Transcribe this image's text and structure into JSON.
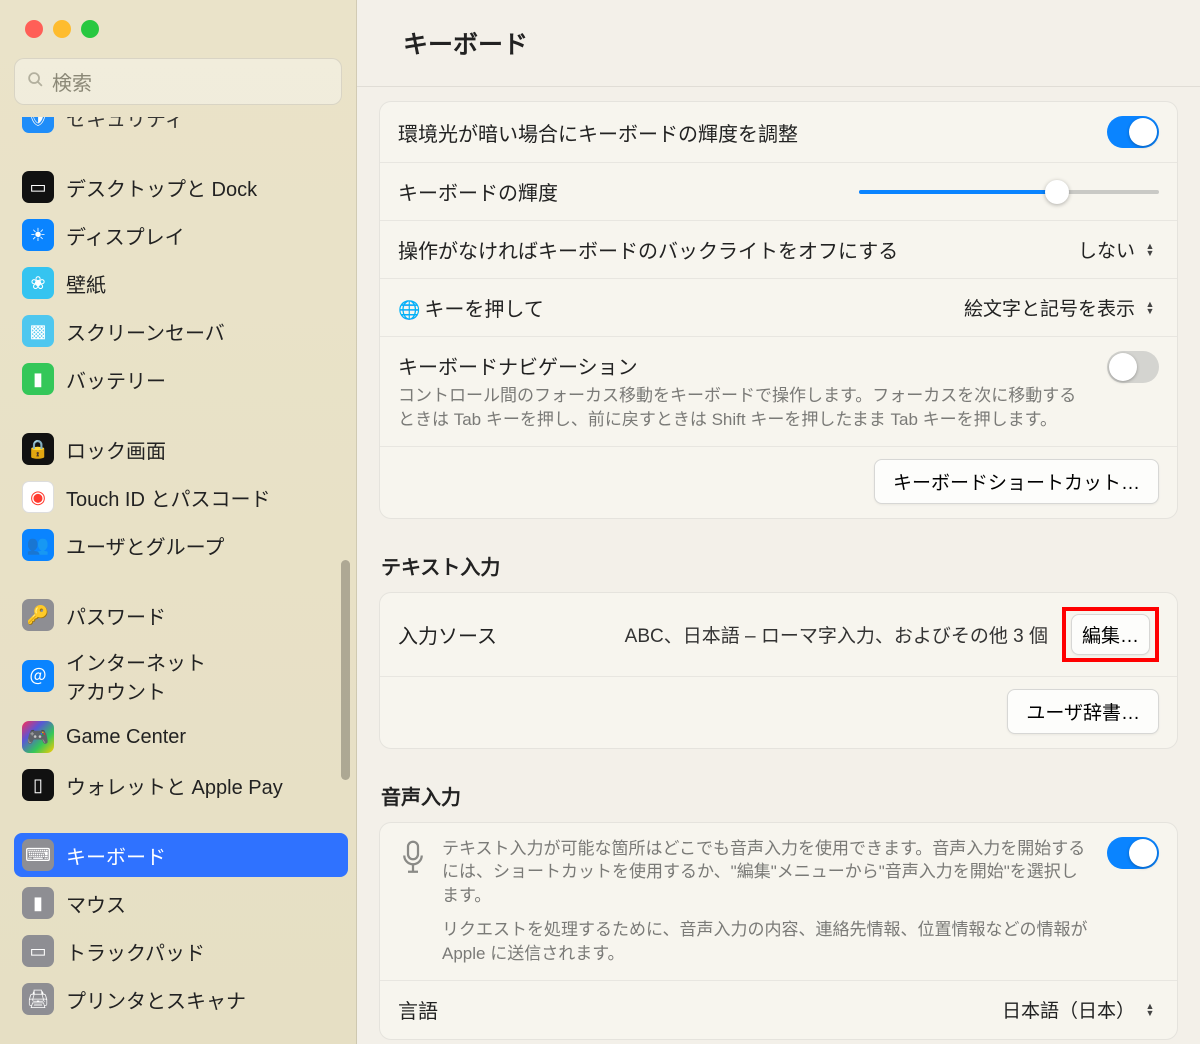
{
  "window": {
    "title": "キーボード"
  },
  "search": {
    "placeholder": "検索"
  },
  "sidebar": {
    "items": [
      {
        "label": "セキュリティ",
        "icon": "security",
        "bg": "#0a84ff"
      },
      {
        "label": "デスクトップと Dock",
        "icon": "desktop",
        "bg": "#111"
      },
      {
        "label": "ディスプレイ",
        "icon": "display",
        "bg": "#0a84ff"
      },
      {
        "label": "壁紙",
        "icon": "wallpaper",
        "bg": "#35c4f0"
      },
      {
        "label": "スクリーンセーバ",
        "icon": "screensaver",
        "bg": "#4fc7ef"
      },
      {
        "label": "バッテリー",
        "icon": "battery",
        "bg": "#34c759"
      },
      {
        "label": "ロック画面",
        "icon": "lock",
        "bg": "#111"
      },
      {
        "label": "Touch ID とパスコード",
        "icon": "touchid",
        "bg": "#fff"
      },
      {
        "label": "ユーザとグループ",
        "icon": "users",
        "bg": "#0a84ff"
      },
      {
        "label": "パスワード",
        "icon": "passwords",
        "bg": "#8e8e93"
      },
      {
        "label": "インターネット\nアカウント",
        "icon": "internet",
        "bg": "#0a84ff"
      },
      {
        "label": "Game Center",
        "icon": "gamecenter",
        "bg": "#fff"
      },
      {
        "label": "ウォレットと Apple Pay",
        "icon": "wallet",
        "bg": "#111"
      },
      {
        "label": "キーボード",
        "icon": "keyboard",
        "bg": "#8e8e93"
      },
      {
        "label": "マウス",
        "icon": "mouse",
        "bg": "#8e8e93"
      },
      {
        "label": "トラックパッド",
        "icon": "trackpad",
        "bg": "#8e8e93"
      },
      {
        "label": "プリンタとスキャナ",
        "icon": "printer",
        "bg": "#8e8e93"
      }
    ],
    "selected": "キーボード"
  },
  "main": {
    "brightness_label": "環境光が暗い場合にキーボードの輝度を調整",
    "brightness_on": true,
    "kbd_brightness_label": "キーボードの輝度",
    "backlight_off_label": "操作がなければキーボードのバックライトをオフにする",
    "backlight_off_value": "しない",
    "globe_key_label": "キーを押して",
    "globe_key_value": "絵文字と記号を表示",
    "kbd_nav_label": "キーボードナビゲーション",
    "kbd_nav_desc": "コントロール間のフォーカス移動をキーボードで操作します。フォーカスを次に移動するときは Tab キーを押し、前に戻すときは Shift キーを押したまま Tab キーを押します。",
    "kbd_nav_on": false,
    "kbd_shortcuts_btn": "キーボードショートカット…",
    "text_input_h": "テキスト入力",
    "input_source_label": "入力ソース",
    "input_source_value": "ABC、日本語 – ローマ字入力、およびその他 3 個",
    "edit_btn": "編集…",
    "user_dict_btn": "ユーザ辞書…",
    "voice_h": "音声入力",
    "voice_desc1": "テキスト入力が可能な箇所はどこでも音声入力を使用できます。音声入力を開始するには、ショートカットを使用するか、\"編集\"メニューから\"音声入力を開始\"を選択します。",
    "voice_desc2": "リクエストを処理するために、音声入力の内容、連絡先情報、位置情報などの情報が Apple に送信されます。",
    "voice_on": true,
    "lang_label": "言語",
    "lang_value": "日本語（日本）"
  },
  "icons": {
    "security": "🛡",
    "desktop": "▭",
    "display": "☀",
    "wallpaper": "❀",
    "screensaver": "▩",
    "battery": "▮",
    "lock": "🔒",
    "touchid": "◉",
    "users": "👥",
    "passwords": "🔑",
    "internet": "＠",
    "gamecenter": "🎮",
    "wallet": "▯",
    "keyboard": "⌨",
    "mouse": "▮",
    "trackpad": "▭",
    "printer": "🖨"
  }
}
